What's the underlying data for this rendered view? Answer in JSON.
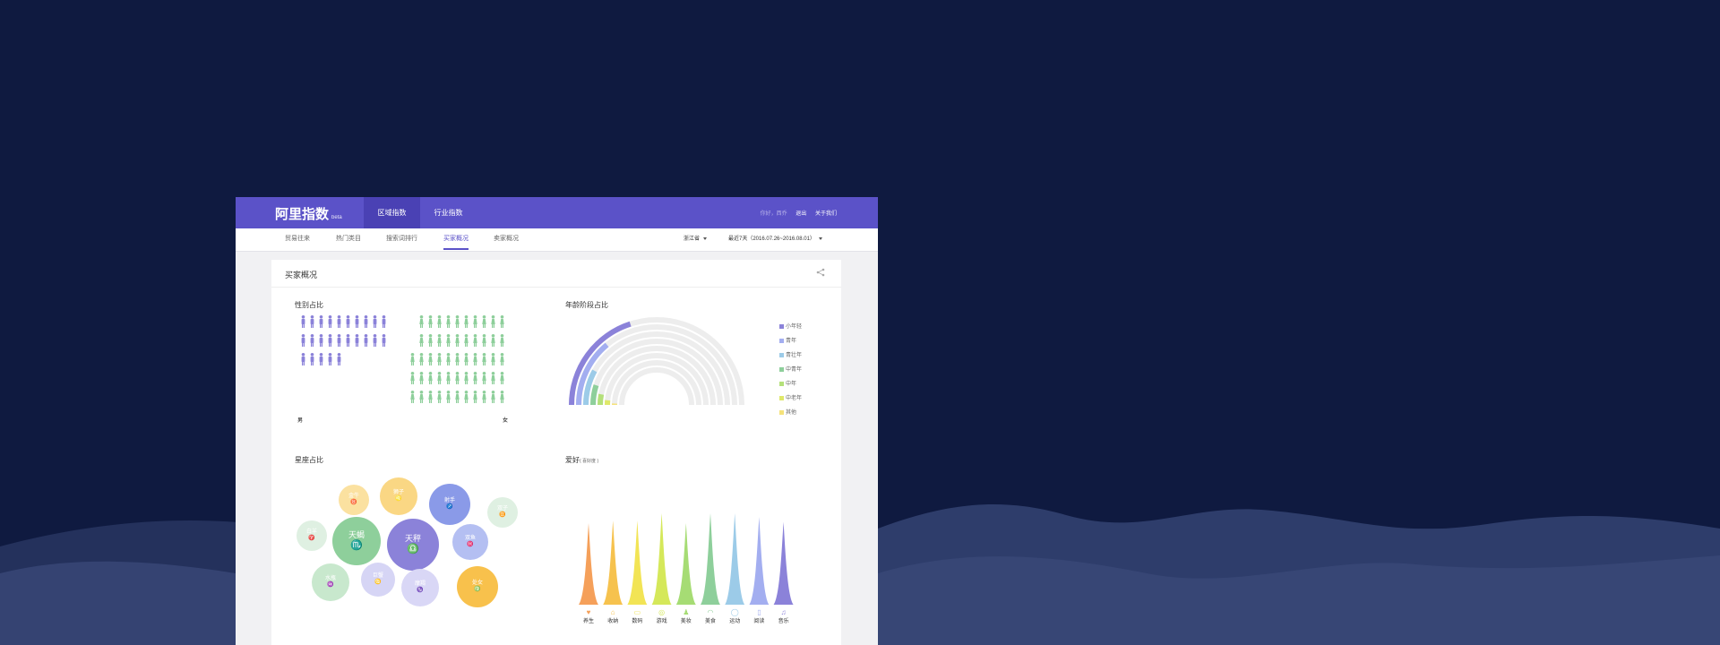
{
  "app": {
    "name": "阿里指数",
    "badge": "beta"
  },
  "nav": {
    "tabs": [
      {
        "label": "区域指数",
        "active": true
      },
      {
        "label": "行业指数",
        "active": false
      }
    ]
  },
  "user": {
    "greeting": "你好，西乔",
    "logout": "退出",
    "about": "关于我们"
  },
  "subnav": {
    "tabs": [
      {
        "label": "贸易往来",
        "active": false
      },
      {
        "label": "热门类目",
        "active": false
      },
      {
        "label": "搜索词排行",
        "active": false
      },
      {
        "label": "买家概况",
        "active": true
      },
      {
        "label": "卖家概况",
        "active": false
      }
    ]
  },
  "filters": {
    "region": "浙江省",
    "period": "最近7天（2016.07.26~2016.08.01）"
  },
  "card": {
    "title": "买家概况",
    "share_icon": "share-icon"
  },
  "gender": {
    "title": "性别占比",
    "male_label": "男",
    "female_label": "女",
    "male_fraction": 0.46,
    "female_fraction": 0.54,
    "male_color": "#8b82d9",
    "female_color": "#8ecf9b"
  },
  "age": {
    "title": "年龄阶段占比",
    "legend": [
      {
        "label": "小年轻",
        "color": "#8b82d9",
        "value": 0.4
      },
      {
        "label": "青年",
        "color": "#a3aef0",
        "value": 0.28
      },
      {
        "label": "青壮年",
        "color": "#9ccbe8",
        "value": 0.16
      },
      {
        "label": "中青年",
        "color": "#8ecf9b",
        "value": 0.1
      },
      {
        "label": "中年",
        "color": "#b4e07a",
        "value": 0.06
      },
      {
        "label": "中老年",
        "color": "#dfe86a",
        "value": 0.03
      },
      {
        "label": "其他",
        "color": "#f5e27a",
        "value": 0.01
      }
    ]
  },
  "zodiac": {
    "title": "星座占比",
    "signs": [
      {
        "name": "金牛",
        "glyph": "♉",
        "color": "#fbe1a0"
      },
      {
        "name": "狮子",
        "glyph": "♌",
        "color": "#fad784"
      },
      {
        "name": "射手",
        "glyph": "♐",
        "color": "#8a9ae8"
      },
      {
        "name": "双子",
        "glyph": "♊",
        "color": "#dff0e2"
      },
      {
        "name": "白羊",
        "glyph": "♈",
        "color": "#dff0e2"
      },
      {
        "name": "天蝎",
        "glyph": "♏",
        "color": "#8ecf9b"
      },
      {
        "name": "天秤",
        "glyph": "♎",
        "color": "#8b82d9"
      },
      {
        "name": "双鱼",
        "glyph": "♓",
        "color": "#b4bff2"
      },
      {
        "name": "水瓶",
        "glyph": "♒",
        "color": "#c8e8cd"
      },
      {
        "name": "巨蟹",
        "glyph": "♋",
        "color": "#d6d5f5"
      },
      {
        "name": "摩羯",
        "glyph": "♑",
        "color": "#d9d7f6"
      },
      {
        "name": "处女",
        "glyph": "♍",
        "color": "#f8c14c"
      }
    ]
  },
  "hobby": {
    "title": "爱好",
    "subtitle": "( 喜好度 )"
  },
  "chart_data": {
    "type": "area",
    "categories": [
      "养生",
      "收纳",
      "数码",
      "游戏",
      "美妆",
      "美食",
      "运动",
      "阅读",
      "音乐"
    ],
    "values": [
      0.66,
      0.68,
      0.68,
      0.74,
      0.66,
      0.74,
      0.74,
      0.71,
      0.67
    ],
    "colors": [
      "#f5a05a",
      "#f6c24e",
      "#f2e455",
      "#d5e85a",
      "#a6dc74",
      "#8ecf9b",
      "#9ccbe8",
      "#a3aef0",
      "#8b82d9"
    ],
    "icons": [
      "heart-icon",
      "box-icon",
      "folder-icon",
      "gamepad-icon",
      "lipstick-icon",
      "bowl-icon",
      "chat-icon",
      "book-icon",
      "headphone-icon"
    ],
    "title": "爱好",
    "xlabel": "",
    "ylabel": "",
    "grid": false
  }
}
